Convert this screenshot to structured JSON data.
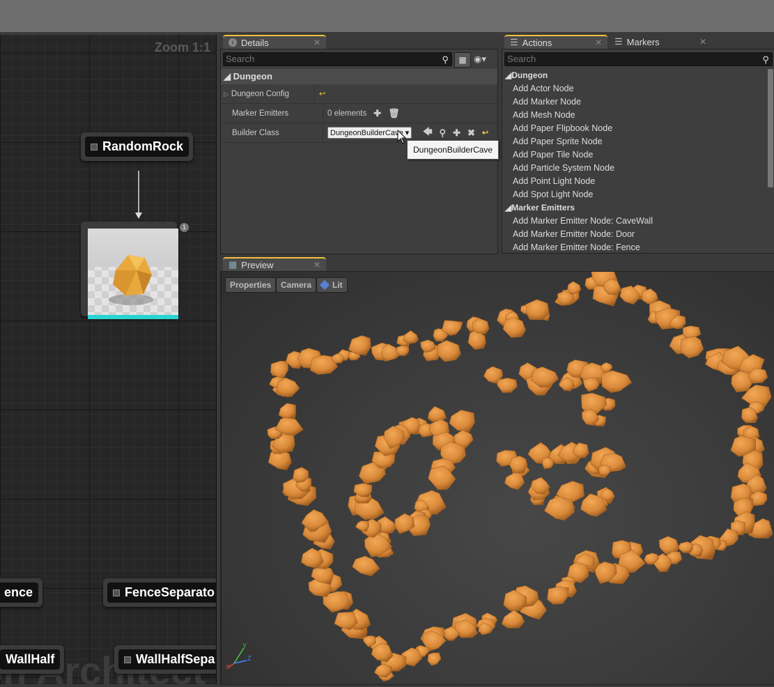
{
  "graph": {
    "zoom": "Zoom 1:1",
    "watermark": "on Architect",
    "nodes": {
      "random_rock": "RandomRock",
      "fence": "ence",
      "fence_separator": "FenceSeparato",
      "wall_half": "WallHalf",
      "wall_half_separator": "WallHalfSepa"
    },
    "mesh_badge": "1"
  },
  "details": {
    "tab_label": "Details",
    "search_placeholder": "Search",
    "category": "Dungeon",
    "rows": [
      {
        "key": "Dungeon Config",
        "value": ""
      },
      {
        "key": "Marker Emitters",
        "value": "0 elements"
      },
      {
        "key": "Builder Class",
        "value": "DungeonBuilderCave"
      }
    ],
    "tooltip": "DungeonBuilderCave"
  },
  "actions": {
    "tab_label": "Actions",
    "markers_tab_label": "Markers",
    "search_placeholder": "Search",
    "categories": [
      {
        "name": "Dungeon",
        "items": [
          "Add Actor Node",
          "Add Marker Node",
          "Add Mesh Node",
          "Add Paper Flipbook Node",
          "Add Paper Sprite Node",
          "Add Paper Tile Node",
          "Add Particle System Node",
          "Add Point Light Node",
          "Add Spot Light Node"
        ]
      },
      {
        "name": "Marker Emitters",
        "items": [
          "Add Marker Emitter Node: CaveWall",
          "Add Marker Emitter Node: Door",
          "Add Marker Emitter Node: Fence"
        ]
      }
    ]
  },
  "preview": {
    "tab_label": "Preview",
    "buttons": {
      "properties": "Properties",
      "camera": "Camera",
      "lit": "Lit"
    },
    "axis_labels": {
      "x": "X",
      "y": "Y",
      "z": "Z"
    }
  },
  "colors": {
    "rock": "#d98a3a",
    "accent_cyan": "#2ad4d4",
    "tab_highlight": "#f0c040"
  }
}
